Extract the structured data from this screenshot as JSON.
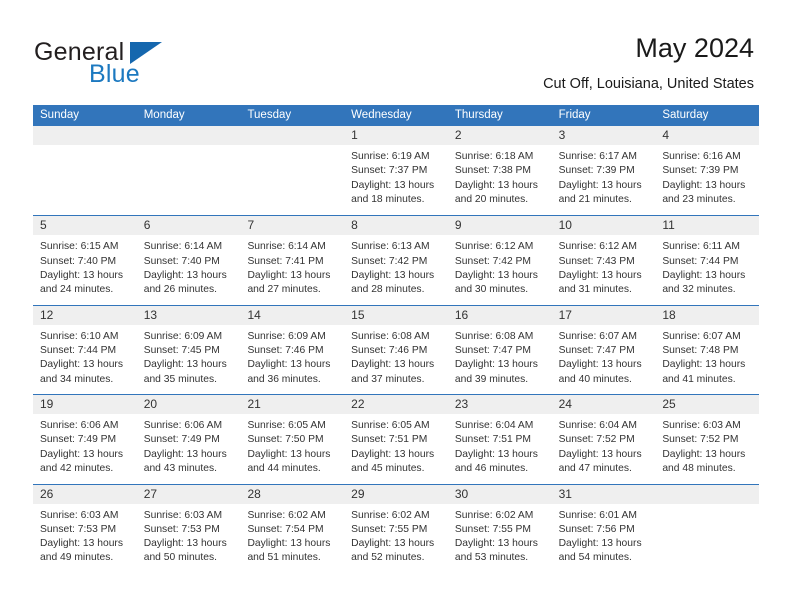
{
  "brand": {
    "name_part1": "General",
    "name_part2": "Blue",
    "accent_color": "#1567ae"
  },
  "header": {
    "title": "May 2024",
    "location": "Cut Off, Louisiana, United States"
  },
  "colors": {
    "header_bar": "#3275bb",
    "daynum_band": "#efefef",
    "text": "#333333"
  },
  "weekdays": [
    "Sunday",
    "Monday",
    "Tuesday",
    "Wednesday",
    "Thursday",
    "Friday",
    "Saturday"
  ],
  "weeks": [
    [
      {
        "empty": true
      },
      {
        "empty": true
      },
      {
        "empty": true
      },
      {
        "day": "1",
        "sunrise": "Sunrise: 6:19 AM",
        "sunset": "Sunset: 7:37 PM",
        "daylight": "Daylight: 13 hours and 18 minutes."
      },
      {
        "day": "2",
        "sunrise": "Sunrise: 6:18 AM",
        "sunset": "Sunset: 7:38 PM",
        "daylight": "Daylight: 13 hours and 20 minutes."
      },
      {
        "day": "3",
        "sunrise": "Sunrise: 6:17 AM",
        "sunset": "Sunset: 7:39 PM",
        "daylight": "Daylight: 13 hours and 21 minutes."
      },
      {
        "day": "4",
        "sunrise": "Sunrise: 6:16 AM",
        "sunset": "Sunset: 7:39 PM",
        "daylight": "Daylight: 13 hours and 23 minutes."
      }
    ],
    [
      {
        "day": "5",
        "sunrise": "Sunrise: 6:15 AM",
        "sunset": "Sunset: 7:40 PM",
        "daylight": "Daylight: 13 hours and 24 minutes."
      },
      {
        "day": "6",
        "sunrise": "Sunrise: 6:14 AM",
        "sunset": "Sunset: 7:40 PM",
        "daylight": "Daylight: 13 hours and 26 minutes."
      },
      {
        "day": "7",
        "sunrise": "Sunrise: 6:14 AM",
        "sunset": "Sunset: 7:41 PM",
        "daylight": "Daylight: 13 hours and 27 minutes."
      },
      {
        "day": "8",
        "sunrise": "Sunrise: 6:13 AM",
        "sunset": "Sunset: 7:42 PM",
        "daylight": "Daylight: 13 hours and 28 minutes."
      },
      {
        "day": "9",
        "sunrise": "Sunrise: 6:12 AM",
        "sunset": "Sunset: 7:42 PM",
        "daylight": "Daylight: 13 hours and 30 minutes."
      },
      {
        "day": "10",
        "sunrise": "Sunrise: 6:12 AM",
        "sunset": "Sunset: 7:43 PM",
        "daylight": "Daylight: 13 hours and 31 minutes."
      },
      {
        "day": "11",
        "sunrise": "Sunrise: 6:11 AM",
        "sunset": "Sunset: 7:44 PM",
        "daylight": "Daylight: 13 hours and 32 minutes."
      }
    ],
    [
      {
        "day": "12",
        "sunrise": "Sunrise: 6:10 AM",
        "sunset": "Sunset: 7:44 PM",
        "daylight": "Daylight: 13 hours and 34 minutes."
      },
      {
        "day": "13",
        "sunrise": "Sunrise: 6:09 AM",
        "sunset": "Sunset: 7:45 PM",
        "daylight": "Daylight: 13 hours and 35 minutes."
      },
      {
        "day": "14",
        "sunrise": "Sunrise: 6:09 AM",
        "sunset": "Sunset: 7:46 PM",
        "daylight": "Daylight: 13 hours and 36 minutes."
      },
      {
        "day": "15",
        "sunrise": "Sunrise: 6:08 AM",
        "sunset": "Sunset: 7:46 PM",
        "daylight": "Daylight: 13 hours and 37 minutes."
      },
      {
        "day": "16",
        "sunrise": "Sunrise: 6:08 AM",
        "sunset": "Sunset: 7:47 PM",
        "daylight": "Daylight: 13 hours and 39 minutes."
      },
      {
        "day": "17",
        "sunrise": "Sunrise: 6:07 AM",
        "sunset": "Sunset: 7:47 PM",
        "daylight": "Daylight: 13 hours and 40 minutes."
      },
      {
        "day": "18",
        "sunrise": "Sunrise: 6:07 AM",
        "sunset": "Sunset: 7:48 PM",
        "daylight": "Daylight: 13 hours and 41 minutes."
      }
    ],
    [
      {
        "day": "19",
        "sunrise": "Sunrise: 6:06 AM",
        "sunset": "Sunset: 7:49 PM",
        "daylight": "Daylight: 13 hours and 42 minutes."
      },
      {
        "day": "20",
        "sunrise": "Sunrise: 6:06 AM",
        "sunset": "Sunset: 7:49 PM",
        "daylight": "Daylight: 13 hours and 43 minutes."
      },
      {
        "day": "21",
        "sunrise": "Sunrise: 6:05 AM",
        "sunset": "Sunset: 7:50 PM",
        "daylight": "Daylight: 13 hours and 44 minutes."
      },
      {
        "day": "22",
        "sunrise": "Sunrise: 6:05 AM",
        "sunset": "Sunset: 7:51 PM",
        "daylight": "Daylight: 13 hours and 45 minutes."
      },
      {
        "day": "23",
        "sunrise": "Sunrise: 6:04 AM",
        "sunset": "Sunset: 7:51 PM",
        "daylight": "Daylight: 13 hours and 46 minutes."
      },
      {
        "day": "24",
        "sunrise": "Sunrise: 6:04 AM",
        "sunset": "Sunset: 7:52 PM",
        "daylight": "Daylight: 13 hours and 47 minutes."
      },
      {
        "day": "25",
        "sunrise": "Sunrise: 6:03 AM",
        "sunset": "Sunset: 7:52 PM",
        "daylight": "Daylight: 13 hours and 48 minutes."
      }
    ],
    [
      {
        "day": "26",
        "sunrise": "Sunrise: 6:03 AM",
        "sunset": "Sunset: 7:53 PM",
        "daylight": "Daylight: 13 hours and 49 minutes."
      },
      {
        "day": "27",
        "sunrise": "Sunrise: 6:03 AM",
        "sunset": "Sunset: 7:53 PM",
        "daylight": "Daylight: 13 hours and 50 minutes."
      },
      {
        "day": "28",
        "sunrise": "Sunrise: 6:02 AM",
        "sunset": "Sunset: 7:54 PM",
        "daylight": "Daylight: 13 hours and 51 minutes."
      },
      {
        "day": "29",
        "sunrise": "Sunrise: 6:02 AM",
        "sunset": "Sunset: 7:55 PM",
        "daylight": "Daylight: 13 hours and 52 minutes."
      },
      {
        "day": "30",
        "sunrise": "Sunrise: 6:02 AM",
        "sunset": "Sunset: 7:55 PM",
        "daylight": "Daylight: 13 hours and 53 minutes."
      },
      {
        "day": "31",
        "sunrise": "Sunrise: 6:01 AM",
        "sunset": "Sunset: 7:56 PM",
        "daylight": "Daylight: 13 hours and 54 minutes."
      },
      {
        "empty": true
      }
    ]
  ]
}
